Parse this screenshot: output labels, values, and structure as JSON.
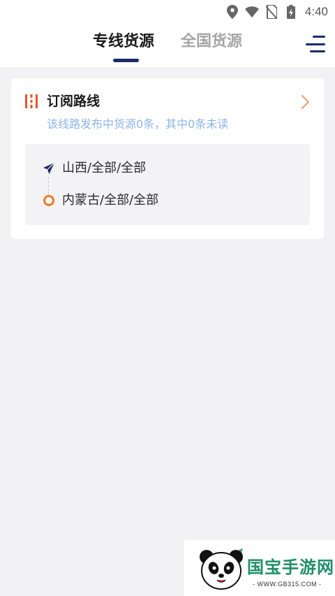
{
  "status_bar": {
    "time": "4:40",
    "icons": [
      "location-icon",
      "wifi-icon",
      "no-sim-icon",
      "battery-charging-icon"
    ]
  },
  "header": {
    "tabs": [
      {
        "label": "专线货源",
        "active": true
      },
      {
        "label": "全国货源",
        "active": false
      }
    ],
    "menu_icon": "menu-icon"
  },
  "subscription_card": {
    "title": "订阅路线",
    "subtitle": "该线路发布中货源0条，其中0条未读",
    "route": {
      "from": "山西/全部/全部",
      "to": "内蒙古/全部/全部"
    }
  },
  "watermark": {
    "name": "国宝手游网",
    "url": "- WWW.GB315.COM -"
  },
  "colors": {
    "accent_navy": "#1d2b66",
    "accent_orange": "#f07a2a",
    "subtitle_blue": "#8fb5e8",
    "background": "#f2f1f3"
  }
}
